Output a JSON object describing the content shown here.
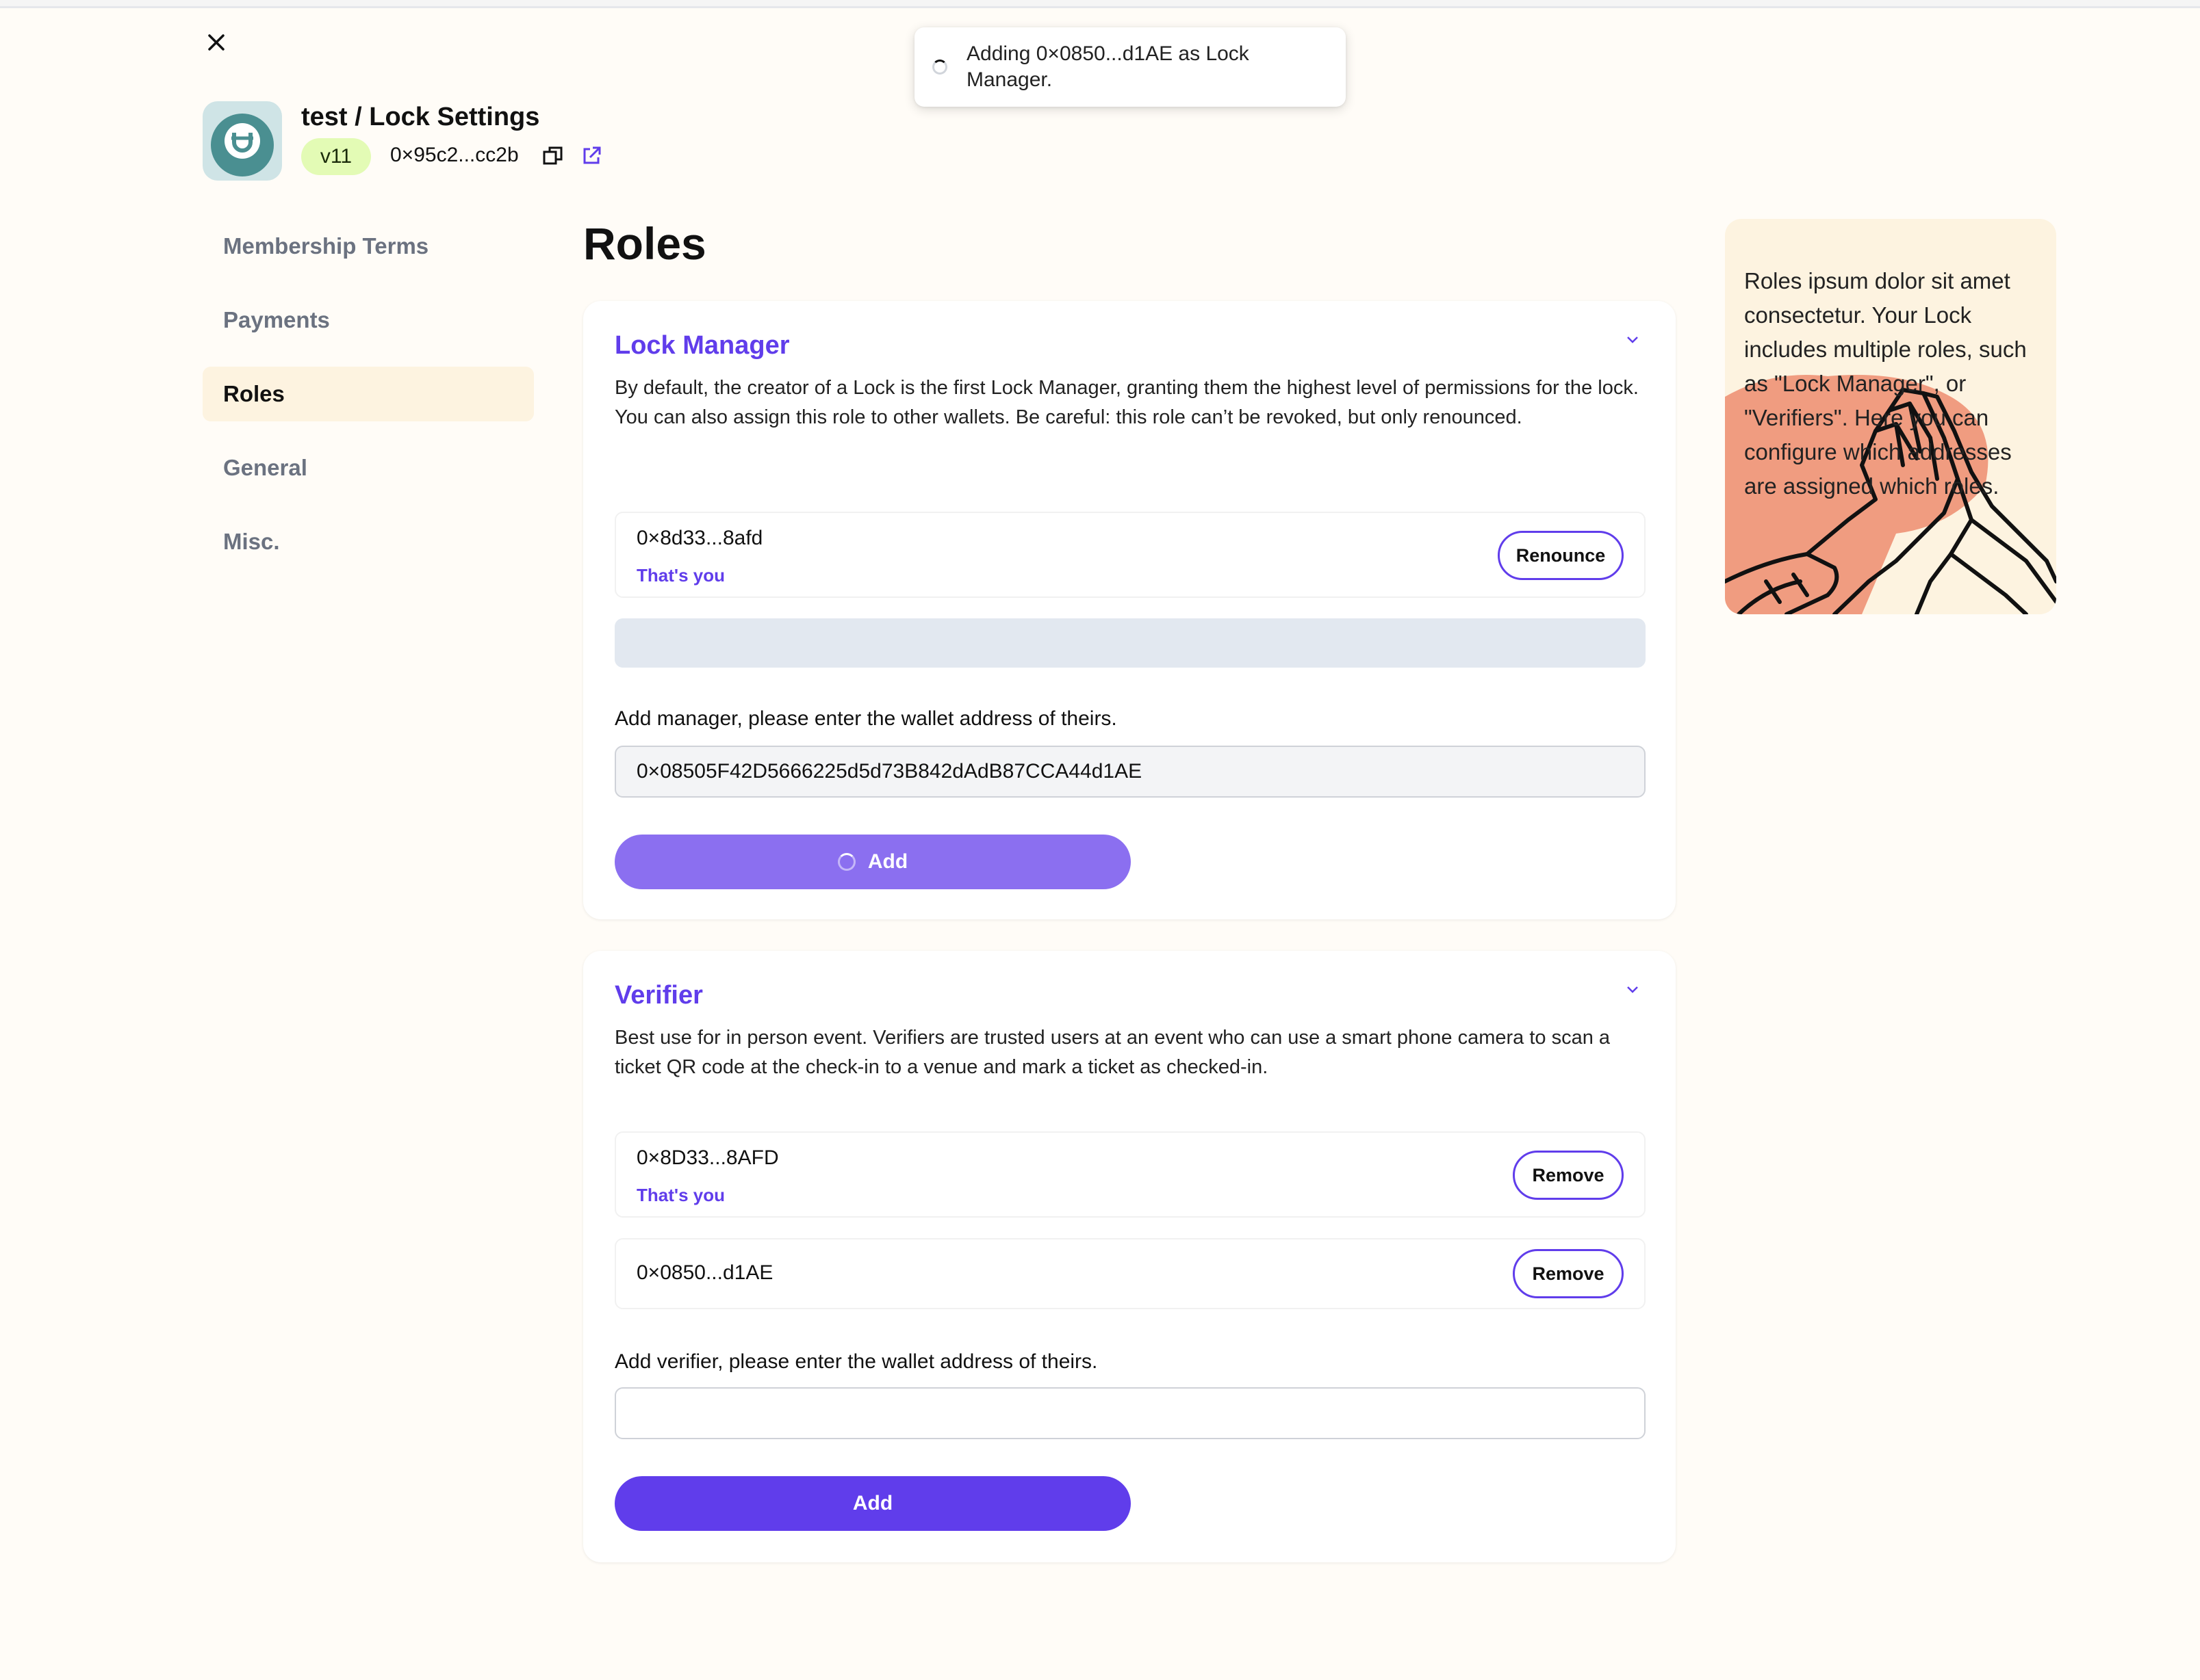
{
  "toast": {
    "message": "Adding 0×0850...d1AE as Lock Manager."
  },
  "header": {
    "title": "test / Lock Settings",
    "version": "v11",
    "address": "0×95c2...cc2b"
  },
  "sidebar": {
    "items": [
      {
        "label": "Membership Terms",
        "active": false
      },
      {
        "label": "Payments",
        "active": false
      },
      {
        "label": "Roles",
        "active": true
      },
      {
        "label": "General",
        "active": false
      },
      {
        "label": "Misc.",
        "active": false
      }
    ]
  },
  "main": {
    "title": "Roles",
    "lock_manager": {
      "title": "Lock Manager",
      "description": "By default, the creator of a Lock is the first Lock Manager, granting them the highest level of permissions for the lock. You can also assign this role to other wallets. Be careful: this role can’t be revoked, but only renounced.",
      "members": [
        {
          "address": "0×8d33...8afd",
          "note": "That's you",
          "action": "Renounce"
        }
      ],
      "add_label": "Add manager, please enter the wallet address of theirs.",
      "input_value": "0×08505F42D5666225d5d73B842dAdB87CCA44d1AE",
      "add_button": "Add"
    },
    "verifier": {
      "title": "Verifier",
      "description": "Best use for in person event. Verifiers are trusted users at an event who can use a smart phone camera to scan a ticket QR code at the check-in to a venue and mark a ticket as checked-in.",
      "members": [
        {
          "address": "0×8D33...8AFD",
          "note": "That's you",
          "action": "Remove"
        },
        {
          "address": "0×0850...d1AE",
          "note": "",
          "action": "Remove"
        }
      ],
      "add_label": "Add verifier, please enter the wallet address of theirs.",
      "input_value": "",
      "add_button": "Add"
    }
  },
  "info_panel": {
    "text": "Roles ipsum dolor sit amet consectetur. Your Lock includes multiple roles, such as \"Lock Manager\", or \"Verifiers\". Here you can configure which addresses are assigned which roles."
  },
  "colors": {
    "accent": "#603deb",
    "background": "#fffcf7",
    "panel": "#fdf3e0",
    "badge": "#e3fbb5",
    "illustration": "#f09c80"
  }
}
